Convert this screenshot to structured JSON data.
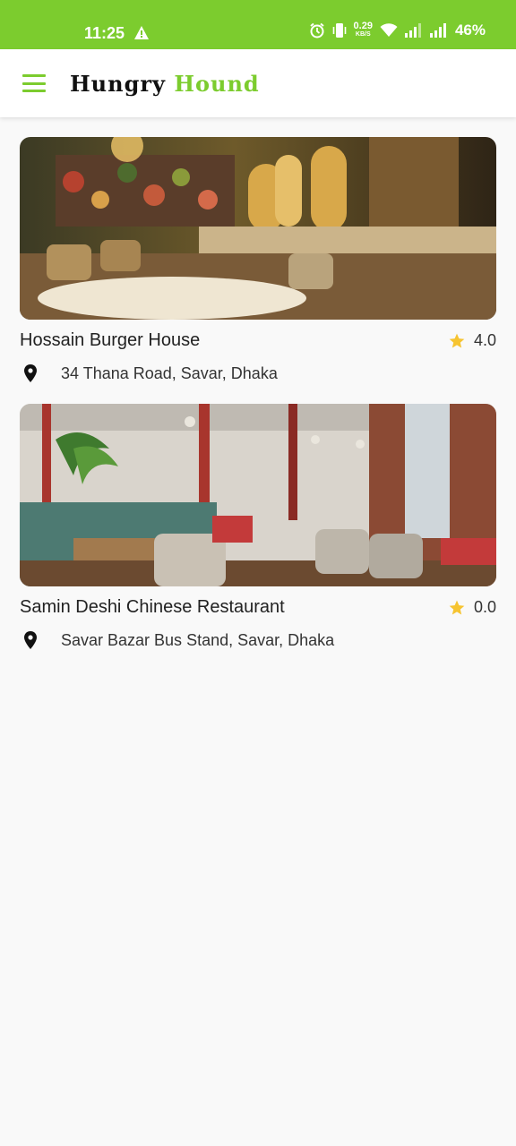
{
  "status_bar": {
    "time": "11:25",
    "net_speed_value": "0.29",
    "net_speed_unit": "KB/S",
    "battery": "46%"
  },
  "app_bar": {
    "brand_first": "Hungry",
    "brand_second": "Hound",
    "accent_color": "#7ccc2e"
  },
  "restaurants": [
    {
      "name": "Hossain Burger House",
      "rating": "4.0",
      "address": "34 Thana Road, Savar, Dhaka"
    },
    {
      "name": "Samin Deshi Chinese Restaurant",
      "rating": "0.0",
      "address": "Savar Bazar Bus Stand, Savar, Dhaka"
    }
  ],
  "icons": [
    "menu-icon",
    "star-icon",
    "location-pin-icon",
    "warning-icon",
    "alarm-icon",
    "vibrate-icon",
    "wifi-icon",
    "signal-icon"
  ]
}
